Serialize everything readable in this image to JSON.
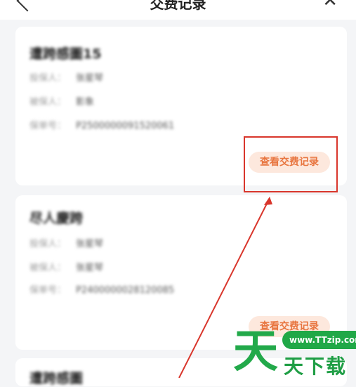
{
  "header": {
    "title": "交费记录",
    "back_icon": "chevron-left-icon",
    "close_icon": "close-icon"
  },
  "cards": [
    {
      "title": "遭跨感圖15",
      "rows": [
        {
          "label": "投保人：",
          "value": "张星琴"
        },
        {
          "label": "被保人：",
          "value": "影象"
        },
        {
          "label": "保单号：",
          "value": "P2500000091520061"
        }
      ],
      "button": "查看交费记录"
    },
    {
      "title": "尽人慶跨",
      "rows": [
        {
          "label": "投保人：",
          "value": "张星琴"
        },
        {
          "label": "被保人：",
          "value": "张星琴"
        },
        {
          "label": "保单号：",
          "value": "P2400000028120085"
        }
      ],
      "button": "查看交费记录"
    },
    {
      "title": "遭跨感圖"
    }
  ],
  "watermark": {
    "big": "天",
    "text": "天下载",
    "url": "www.TTzip.com"
  },
  "colors": {
    "accent": "#e8753f",
    "highlight": "#d9362c",
    "watermark": "#22a94a"
  }
}
